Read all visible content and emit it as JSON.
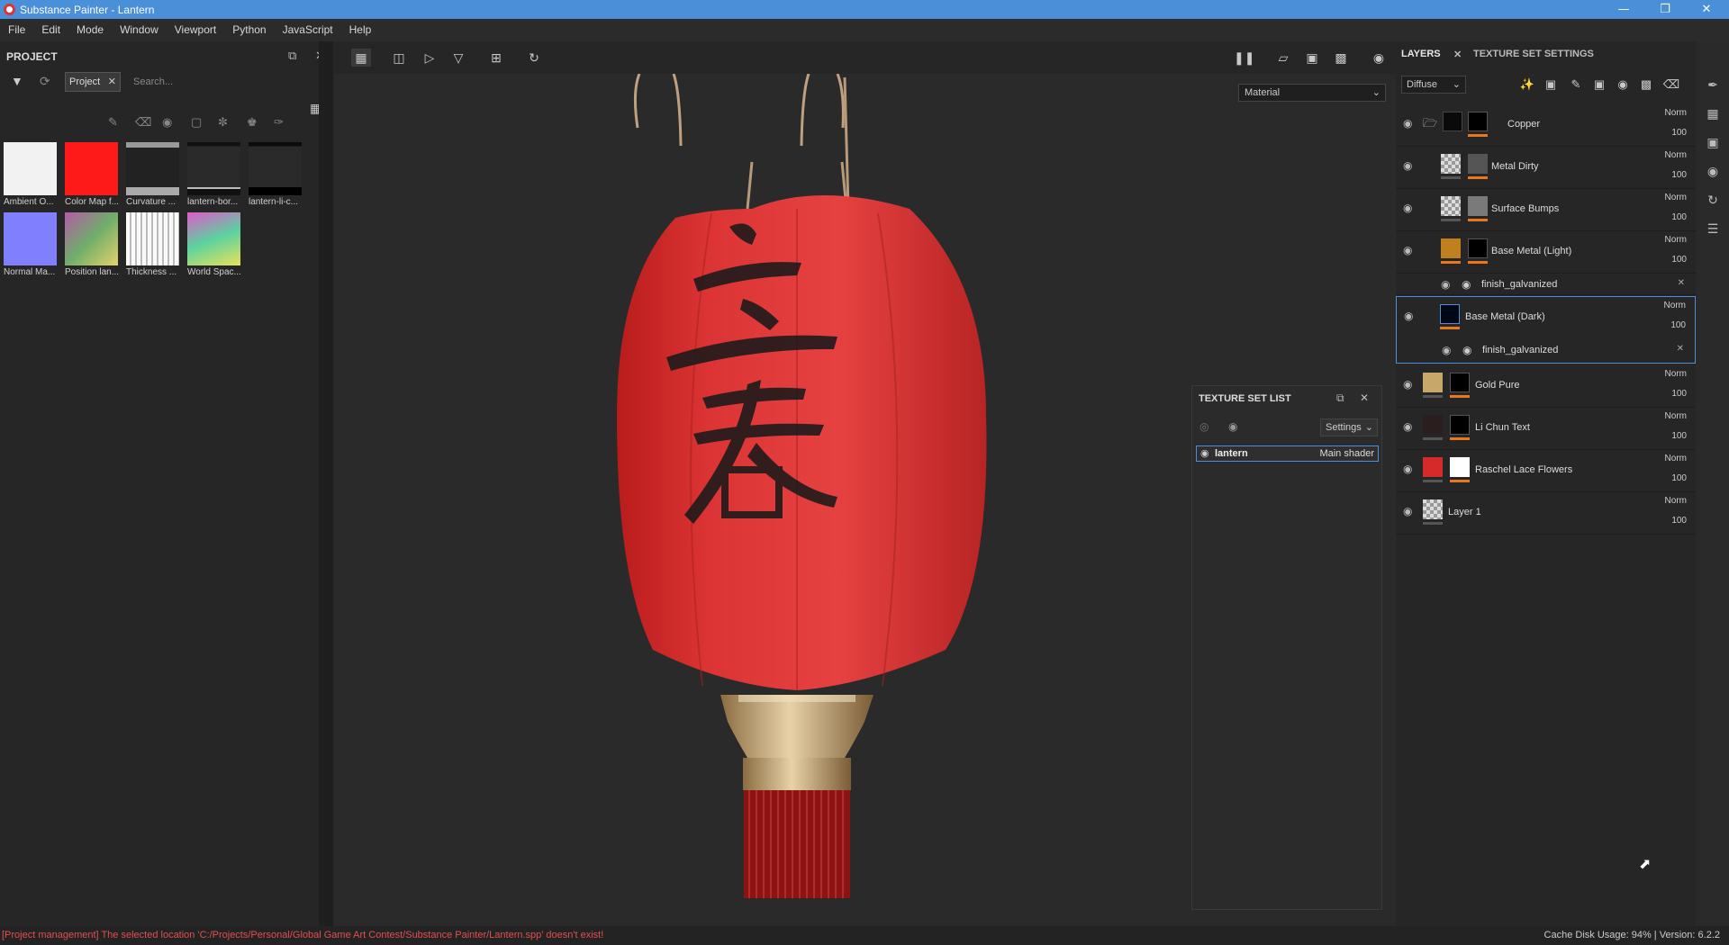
{
  "window": {
    "title": "Substance Painter - Lantern"
  },
  "menu": [
    "File",
    "Edit",
    "Mode",
    "Window",
    "Viewport",
    "Python",
    "JavaScript",
    "Help"
  ],
  "project": {
    "title": "PROJECT",
    "filter_tag": "Project",
    "search_placeholder": "Search...",
    "thumbnails": [
      {
        "label": "Ambient O...",
        "color": "#f2f2f2"
      },
      {
        "label": "Color Map f...",
        "color": "#ff1a1a"
      },
      {
        "label": "Curvature ...",
        "color": "#8a8a8a"
      },
      {
        "label": "lantern-bor...",
        "color": "#111111"
      },
      {
        "label": "lantern-li-c...",
        "color": "#0b0b0b"
      },
      {
        "label": "Normal Ma...",
        "color": "#8080ff"
      },
      {
        "label": "Position lan...",
        "color": "#6fae6a"
      },
      {
        "label": "Thickness ...",
        "color": "#eeeeee"
      },
      {
        "label": "World Spac...",
        "color": "#5bd2a0"
      }
    ]
  },
  "viewport": {
    "mode_select": "Material"
  },
  "texture_set_list": {
    "title": "TEXTURE SET LIST",
    "settings_label": "Settings",
    "sets": [
      {
        "name": "lantern",
        "shader": "Main shader"
      }
    ]
  },
  "layers_panel": {
    "tabs": [
      "LAYERS",
      "TEXTURE SET SETTINGS"
    ],
    "channel": "Diffuse",
    "layers": [
      {
        "name": "Copper",
        "blend": "Norm",
        "opacity": "100",
        "thumb": "#0a0a0a",
        "mask": "#000000"
      },
      {
        "name": "Metal Dirty",
        "blend": "Norm",
        "opacity": "100",
        "thumb": "checker",
        "mask": "#555555"
      },
      {
        "name": "Surface Bumps",
        "blend": "Norm",
        "opacity": "100",
        "thumb": "checker",
        "mask": "#7a7a7a"
      },
      {
        "name": "Base Metal (Light)",
        "blend": "Norm",
        "opacity": "100",
        "thumb": "#c08020",
        "mask": "#000000"
      },
      {
        "effect": "finish_galvanized"
      },
      {
        "name": "Base Metal (Dark)",
        "blend": "Norm",
        "opacity": "100",
        "thumb": "#000818",
        "selected": true
      },
      {
        "effect": "finish_galvanized"
      },
      {
        "name": "Gold Pure",
        "blend": "Norm",
        "opacity": "100",
        "thumb": "#c8a76a",
        "mask": "#000000"
      },
      {
        "name": "Li Chun Text",
        "blend": "Norm",
        "opacity": "100",
        "thumb": "#2a1e1e",
        "mask": "#000000"
      },
      {
        "name": "Raschel Lace Flowers",
        "blend": "Norm",
        "opacity": "100",
        "thumb": "#d42a2a",
        "mask": "#ffffff"
      },
      {
        "name": "Layer 1",
        "blend": "Norm",
        "opacity": "100",
        "thumb": "checker"
      }
    ]
  },
  "status": {
    "error": "[Project management] The selected location 'C:/Projects/Personal/Global Game Art Contest/Substance Painter/Lantern.spp' doesn't exist!",
    "info": "Cache Disk Usage:   94% | Version: 6.2.2"
  }
}
